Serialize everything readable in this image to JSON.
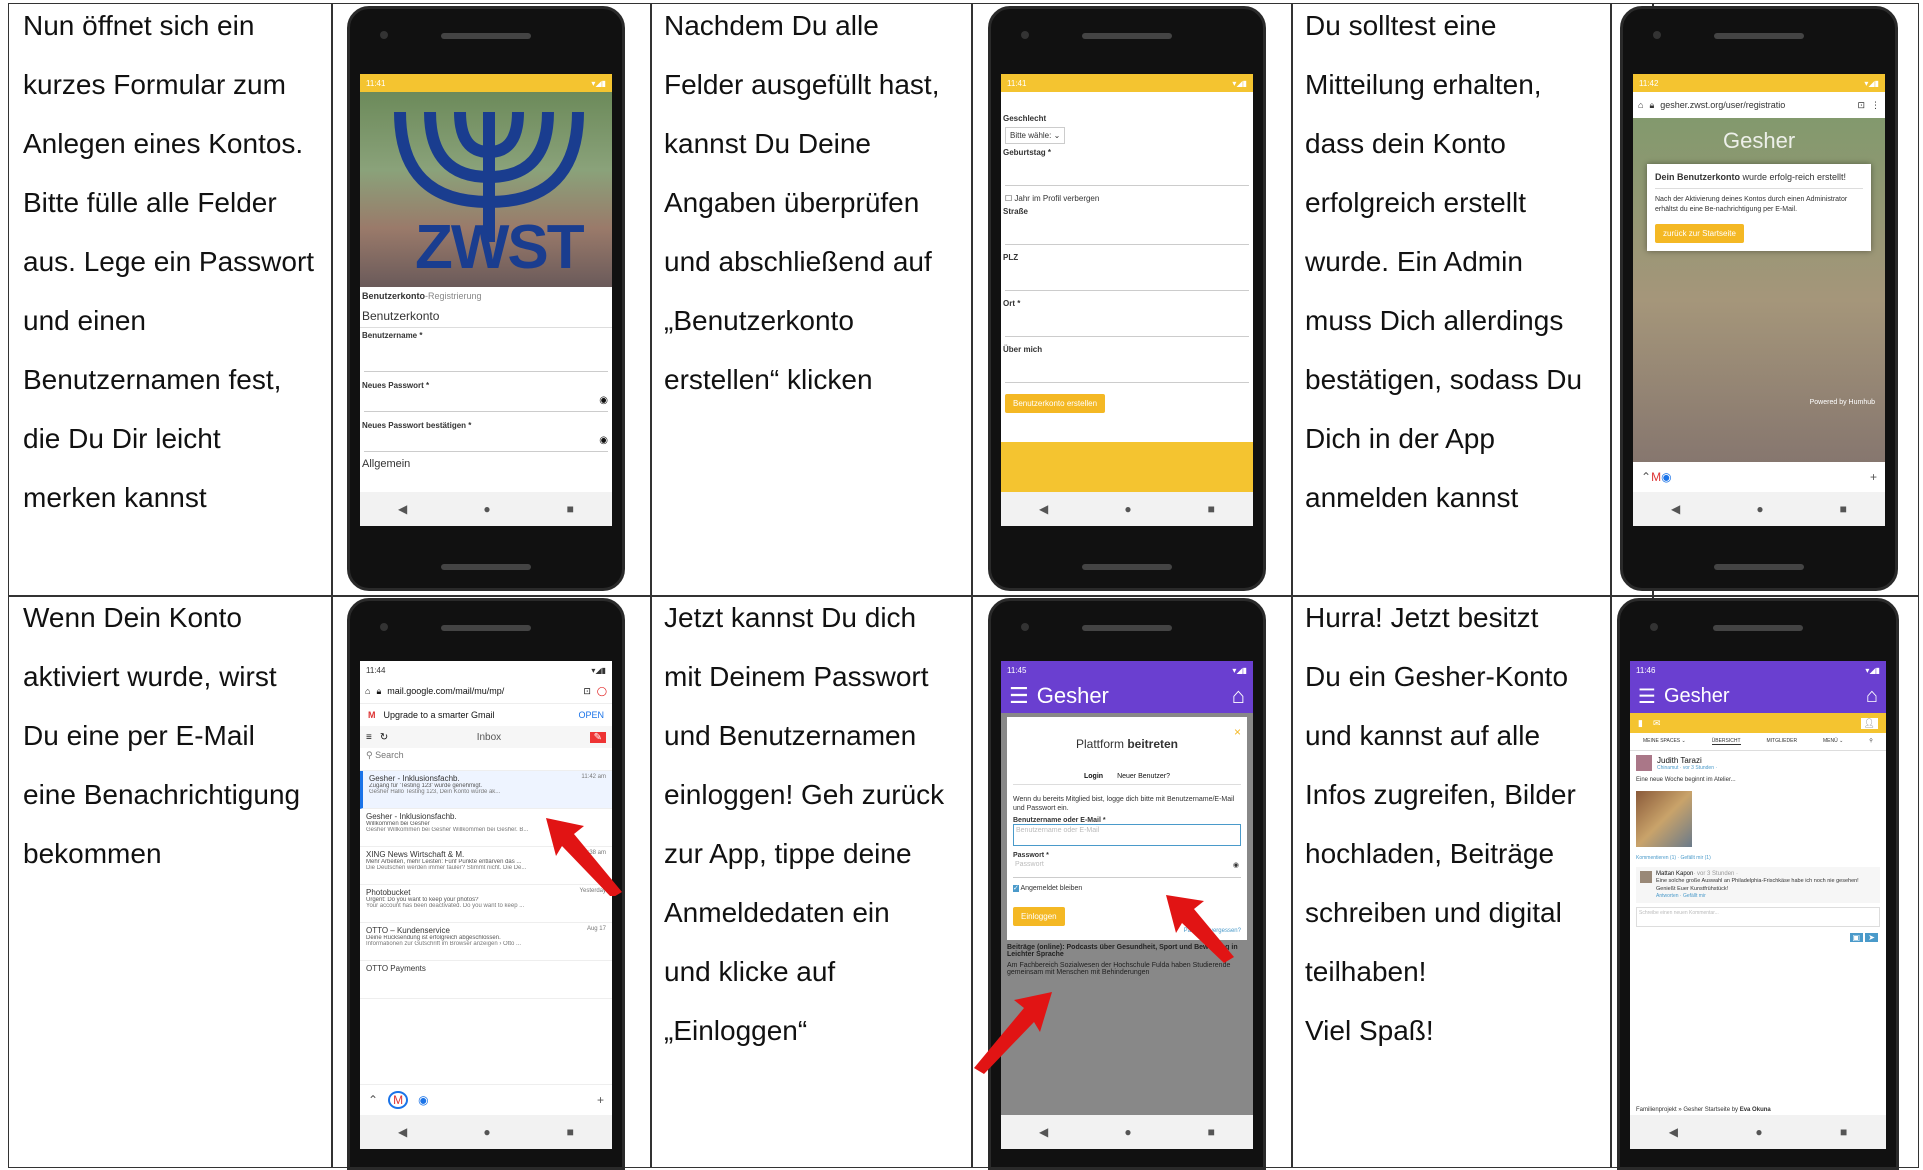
{
  "colors": {
    "accent_yellow": "#f4c430",
    "gesher_purple": "#6a3fd0",
    "arrow_red": "#e11414",
    "zwst_blue": "#1a3d8f"
  },
  "cells": {
    "c1": {
      "lines": [
        "Nun öffnet sich ein",
        "kurzes Formular zum",
        "Anlegen eines Kontos.",
        "Bitte fülle alle Felder",
        "aus. Lege ein Passwort",
        "und einen",
        "Benutzernamen fest,",
        "die Du Dir leicht",
        "merken kannst"
      ]
    },
    "c2": {
      "lines": [
        "Nachdem Du alle",
        "Felder ausgefüllt hast,",
        "kannst Du Deine",
        "Angaben überprüfen",
        "und abschließend auf",
        "„Benutzerkonto",
        "erstellen“ klicken"
      ]
    },
    "c3": {
      "lines": [
        "Du solltest eine",
        "Mitteilung erhalten,",
        "dass dein Konto",
        "erfolgreich erstellt",
        "wurde. Ein Admin",
        "muss Dich allerdings",
        "bestätigen, sodass Du",
        "Dich in der App",
        "anmelden kannst"
      ]
    },
    "c4": {
      "lines": [
        "Wenn Dein Konto",
        "aktiviert wurde, wirst",
        "Du eine per E-Mail",
        "eine Benachrichtigung",
        "bekommen"
      ]
    },
    "c5": {
      "lines": [
        "Jetzt kannst Du dich",
        "mit Deinem Passwort",
        "und Benutzernamen",
        "einloggen! Geh zurück",
        "zur App, tippe deine",
        "Anmeldedaten ein",
        "und klicke auf",
        "„Einloggen“"
      ]
    },
    "c6": {
      "lines": [
        "Hurra! Jetzt besitzt",
        "Du ein Gesher-Konto",
        "und kannst auf alle",
        "Infos zugreifen, Bilder",
        "hochladen, Beiträge",
        "schreiben und digital",
        "teilhaben!",
        "Viel Spaß!"
      ]
    }
  },
  "phone1": {
    "time": "11:41",
    "logo_text": "ZWST",
    "reg_title_bold": "Benutzerkonto",
    "reg_title_rest": "-Registrierung",
    "section": "Benutzerkonto",
    "f1": "Benutzername *",
    "f2": "Neues Passwort *",
    "f3": "Neues Passwort bestätigen *",
    "f4": "Allgemein"
  },
  "phone2": {
    "time": "11:41",
    "f1": "Geschlecht",
    "select": "Bitte wähle: ⌄",
    "f2": "Geburtstag *",
    "check": "Jahr im Profil verbergen",
    "f3": "Straße",
    "f4": "PLZ",
    "f5": "Ort *",
    "f6": "Über mich",
    "button": "Benutzerkonto erstellen"
  },
  "phone3": {
    "time": "11:42",
    "url": "gesher.zwst.org/user/registratio",
    "brand": "Gesher",
    "msg_bold": "Dein Benutzerkonto",
    "msg_rest": " wurde erfolg-reich erstellt!",
    "msg2": "Nach der Aktivierung deines Kontos durch einen Administrator erhältst du eine Be-nachrichtigung per E-Mail.",
    "button": "zurück zur Startseite",
    "powered": "Powered by Humhub"
  },
  "phone4": {
    "time": "11:44",
    "url": "mail.google.com/mail/mu/mp/",
    "banner": "Upgrade to a smarter Gmail",
    "open": "OPEN",
    "inbox": "Inbox",
    "search": "Search",
    "mails": [
      {
        "from": "Gesher - Inklusionsfachb.",
        "time": "11:42 am",
        "l1": "Zugang für 'Testing 123' wurde genehmigt.",
        "l2": "Gesher Hallo Testing 123, Dein Konto wurde ak..."
      },
      {
        "from": "Gesher - Inklusionsfachb.",
        "time": "",
        "l1": "Willkommen bei Gesher",
        "l2": "Gesher Willkommen bei Gesher Willkommen bei Gesher. B..."
      },
      {
        "from": "XING News Wirtschaft & M.",
        "time": "8:38 am",
        "l1": "Mehr Arbeiten, mehr Leisten: Fünf Punkte entlarven das ...",
        "l2": "Die Deutschen werden immer fauler? Stimmt nicht. Die De..."
      },
      {
        "from": "Photobucket",
        "time": "Yesterday",
        "l1": "Urgent: Do you want to keep your photos?",
        "l2": "Your account has been deactivated. Do you want to keep ..."
      },
      {
        "from": "OTTO – Kundenservice",
        "time": "Aug 17",
        "l1": "Deine Rücksendung ist erfolgreich abgeschlossen.",
        "l2": "Informationen zur Gutschrift im Browser anzeigen › Otto ..."
      },
      {
        "from": "OTTO Payments",
        "time": "",
        "l1": "",
        "l2": ""
      }
    ]
  },
  "phone5": {
    "time": "11:45",
    "brand": "Gesher",
    "title_light": "Plattform ",
    "title_bold": "beitreten",
    "tab1": "Login",
    "tab2": "Neuer Benutzer?",
    "intro": "Wenn du bereits Mitglied bist, logge dich bitte mit Benutzername/E-Mail und Passwort ein.",
    "user_label": "Benutzername oder E-Mail *",
    "user_ph": "Benutzername oder E-Mail",
    "pw_label": "Passwort *",
    "pw_ph": "Passwort",
    "remember": "Angemeldet bleiben",
    "login": "Einloggen",
    "forgot": "Passwort vergessen?",
    "bg1": "Beiträge (online): Podcasts über Gesundheit, Sport und Bewegung in Leichter Sprache",
    "bg2": "Am Fachbereich Sozialwesen der Hochschule Fulda haben Studierende gemeinsam mit Menschen mit Behinderungen"
  },
  "phone6": {
    "time": "11:46",
    "brand": "Gesher",
    "tabs": [
      "MEINE SPACES ⌄",
      "ÜBERSICHT",
      "MITGLIEDER",
      "MENÜ ⌄"
    ],
    "author": "Judith Tarazi",
    "meta": "Chinamut · vor 3 Stunden ·",
    "post": "Eine neue Woche beginnt im Atelier...",
    "actions": "Kommentieren (1) · Gefällt mir (1)",
    "c_author": "Mattan Kapon",
    "c_meta": "· vor 3 Stunden ·",
    "c_text": "Eine solche große Auswahl an Philadelphia-Frischkäse habe ich noch nie gesehen! Genießt Euer Kunstfrühstück!",
    "c_actions": "Antworten · Gefällt mir",
    "comment_ph": "Schreibe einen neuen Kommentar...",
    "footer_pre": "Familienprojekt » Gesher Startseite by ",
    "footer_bold": "Eva Okuna"
  }
}
